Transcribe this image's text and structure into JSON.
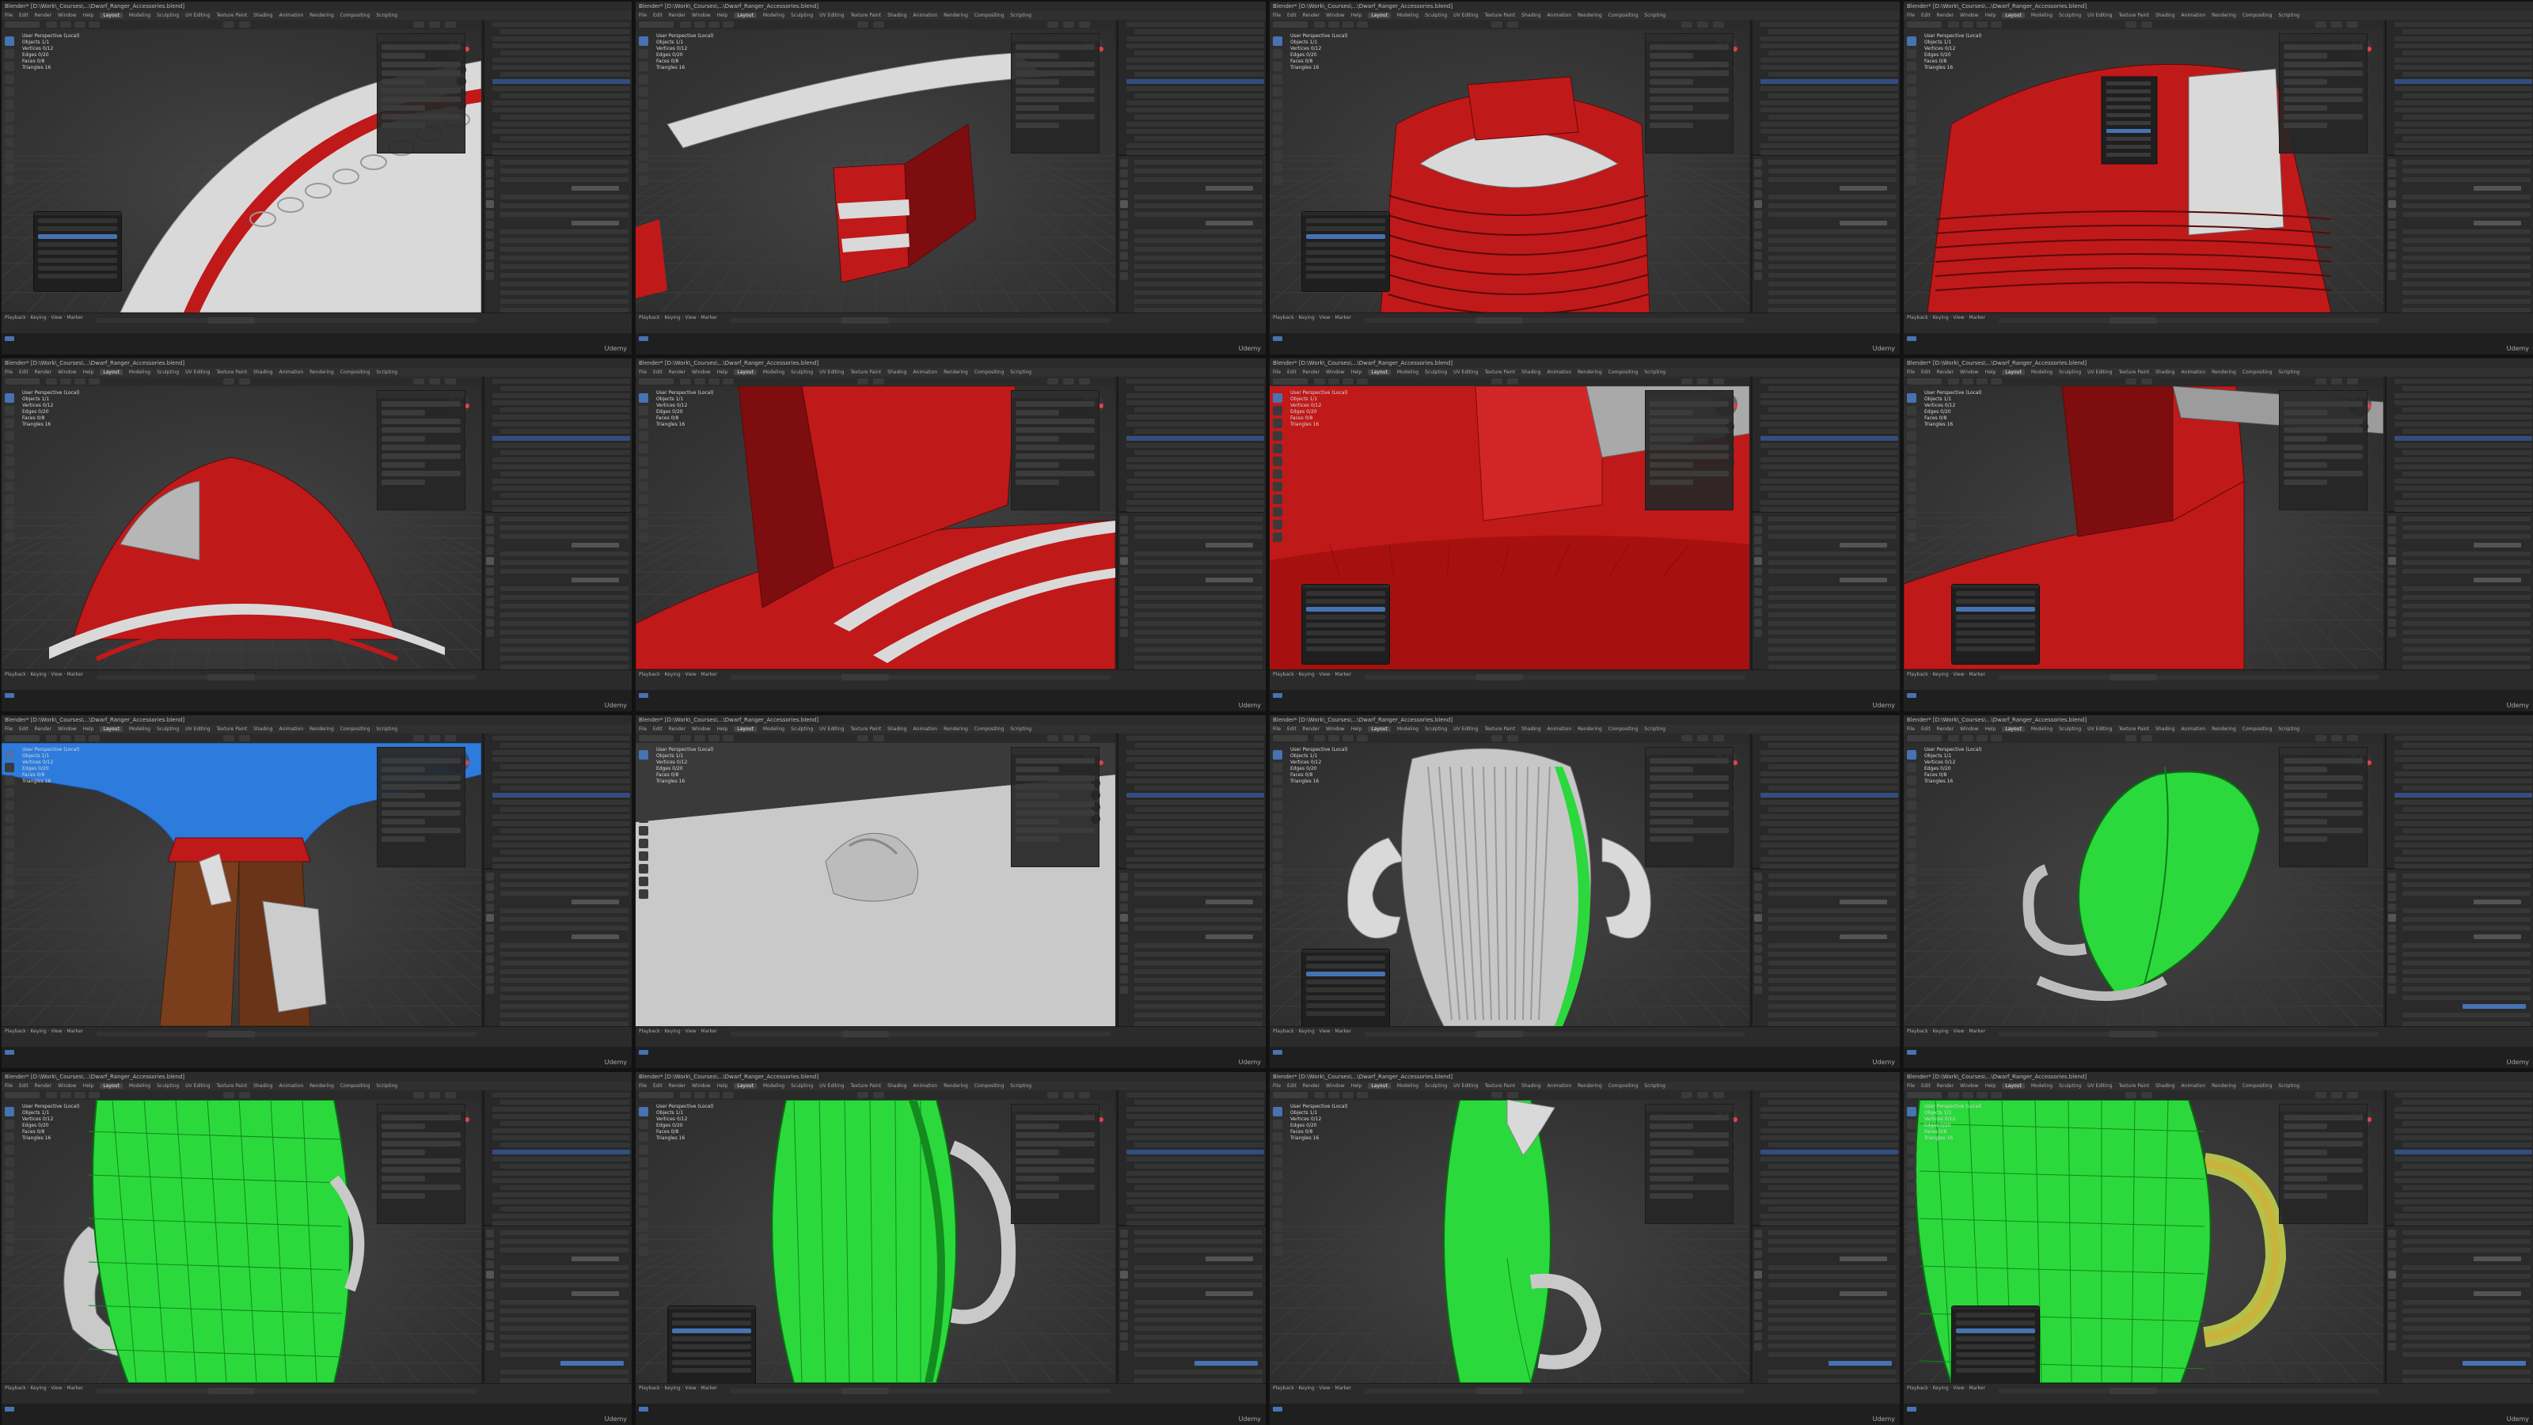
{
  "app": {
    "title": "Blender* [D:\\Work\\_Courses\\...\\Dwarf_Ranger_Accessories.blend]",
    "menu": [
      "File",
      "Edit",
      "Render",
      "Window",
      "Help"
    ],
    "workspaces": [
      "Layout",
      "Modeling",
      "Sculpting",
      "UV Editing",
      "Texture Paint",
      "Shading",
      "Animation",
      "Rendering",
      "Compositing",
      "Scripting"
    ],
    "active_workspace": "Layout",
    "view_label": "User Perspective (Local)",
    "watermark": "Udemy"
  },
  "colors": {
    "red": "#c0191a",
    "red_dark": "#7d0d0e",
    "green": "#2bd93d",
    "green_dark": "#148b1e",
    "blue": "#2d7bdc",
    "white_mesh": "#d9d9d9",
    "accent": "#4772b3"
  },
  "tiles": [
    {
      "scene": "white_arc_red_stripe",
      "popup": true,
      "stats": [
        "Objects 1/1",
        "Vertices 0/12",
        "Edges 0/20",
        "Faces 0/8",
        "Triangles 16"
      ]
    },
    {
      "scene": "red_ring_side",
      "popup": false,
      "stats": [
        "Objects 1/1",
        "Vertices 0/12",
        "Edges 0/20",
        "Faces 0/8",
        "Triangles 16"
      ]
    },
    {
      "scene": "red_bucket_top",
      "popup": true,
      "stats": [
        "Objects 1/1",
        "Vertices 0/12",
        "Edges 0/20",
        "Faces 0/8",
        "Triangles 16"
      ]
    },
    {
      "scene": "red_dome_menu",
      "popup": false,
      "stats": [
        "Objects 1/1",
        "Vertices 0/12",
        "Edges 0/20",
        "Faces 0/8",
        "Triangles 16"
      ]
    },
    {
      "scene": "red_arch",
      "popup": false,
      "stats": [
        "Objects 1/1",
        "Vertices 0/12",
        "Edges 0/20",
        "Faces 0/8",
        "Triangles 16"
      ]
    },
    {
      "scene": "red_wall_close",
      "popup": false,
      "stats": [
        "Objects 1/1",
        "Vertices 0/12",
        "Edges 0/20",
        "Faces 0/8",
        "Triangles 16"
      ]
    },
    {
      "scene": "red_full",
      "popup": true,
      "stats": [
        "Objects 1/1",
        "Vertices 0/12",
        "Edges 0/20",
        "Faces 0/8",
        "Triangles 16"
      ]
    },
    {
      "scene": "red_corner",
      "popup": true,
      "stats": [
        "Objects 1/1",
        "Vertices 0/12",
        "Edges 0/20",
        "Faces 0/8",
        "Triangles 16"
      ]
    },
    {
      "scene": "character",
      "popup": false,
      "stats": [
        "Objects 1/1",
        "Vertices 0/12",
        "Edges 0/20",
        "Faces 0/8",
        "Triangles 16"
      ]
    },
    {
      "scene": "white_plane",
      "popup": false,
      "stats": [
        "Objects 1/1",
        "Vertices 0/12",
        "Edges 0/20",
        "Faces 0/8",
        "Triangles 16"
      ]
    },
    {
      "scene": "sculpt_gourd",
      "popup": true,
      "stats": [
        "Objects 1/1",
        "Vertices 0/12",
        "Edges 0/20",
        "Faces 0/8",
        "Triangles 16"
      ]
    },
    {
      "scene": "green_leaf",
      "popup": false,
      "stats": [
        "Objects 1/1",
        "Vertices 0/12",
        "Edges 0/20",
        "Faces 0/8",
        "Triangles 16"
      ]
    },
    {
      "scene": "green_gourd_a",
      "popup": false,
      "stats": [
        "Objects 1/1",
        "Vertices 0/12",
        "Edges 0/20",
        "Faces 0/8",
        "Triangles 16"
      ]
    },
    {
      "scene": "green_gourd_b",
      "popup": true,
      "stats": [
        "Objects 1/1",
        "Vertices 0/12",
        "Edges 0/20",
        "Faces 0/8",
        "Triangles 16"
      ]
    },
    {
      "scene": "green_gourd_c",
      "popup": false,
      "stats": [
        "Objects 1/1",
        "Vertices 0/12",
        "Edges 0/20",
        "Faces 0/8",
        "Triangles 16"
      ]
    },
    {
      "scene": "green_gourd_d",
      "popup": true,
      "stats": [
        "Objects 1/1",
        "Vertices 0/12",
        "Edges 0/20",
        "Faces 0/8",
        "Triangles 16"
      ]
    }
  ]
}
